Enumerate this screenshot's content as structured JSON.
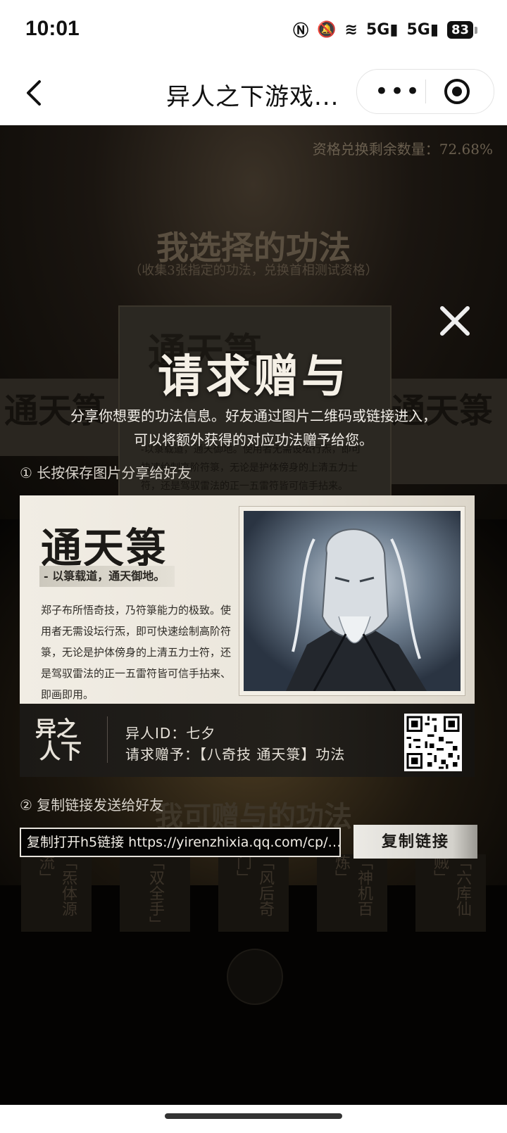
{
  "status_bar": {
    "time": "10:01",
    "nfc_icon": "nfc-icon",
    "mute_icon": "bell-off-icon",
    "wifi_icon": "wifi-icon",
    "network_1": "5G",
    "network_2": "5G",
    "battery": "83"
  },
  "nav": {
    "title": "异人之下游戏...",
    "more_label": "•••"
  },
  "background": {
    "quota": "资格兑换剩余数量：72.68%",
    "section_title": "我选择的功法",
    "section_sub": "（收集3张指定的功法，兑换首相测试资格）",
    "card_title": "通天箓",
    "card_lines": "-以箓载道，通天御地。使用者无需设坛行炁，即可快速绘制高阶符箓，无论是护体傍身的上清五力士符，还是驾驭雷法的正一五雷符皆可信手拈来。",
    "side_left": "通天箓",
    "side_right": "通天箓",
    "section2_title": "我可赠与的功法",
    "pillars": [
      "「炁体源流」",
      "「双全手」",
      "「风后奇门」",
      "「神机百炼」",
      "「六库仙贼」"
    ]
  },
  "modal": {
    "title": "请求赠与",
    "desc_line1": "分享你想要的功法信息。好友通过图片二维码或链接进入，",
    "desc_line2": "可以将额外获得的对应功法赠予给您。",
    "step1": "① 长按保存图片分享给好友",
    "step2": "② 复制链接发送给好友",
    "share_card": {
      "technique_name": "通天箓",
      "motto": "- 以箓载道，通天御地。",
      "description": "郑子布所悟奇技，乃符箓能力的极致。使用者无需设坛行炁，即可快速绘制高阶符箓，无论是护体傍身的上清五力士符，还是驾驭雷法的正一五雷符皆可信手拈来、即画即用。",
      "user_id": "异人ID：七夕",
      "request": "请求赠予：【八奇技 通天箓】功法"
    },
    "link_text": "复制打开h5链接 https://yirenzhixia.qq.com/cp/…",
    "copy_button": "复制链接"
  }
}
